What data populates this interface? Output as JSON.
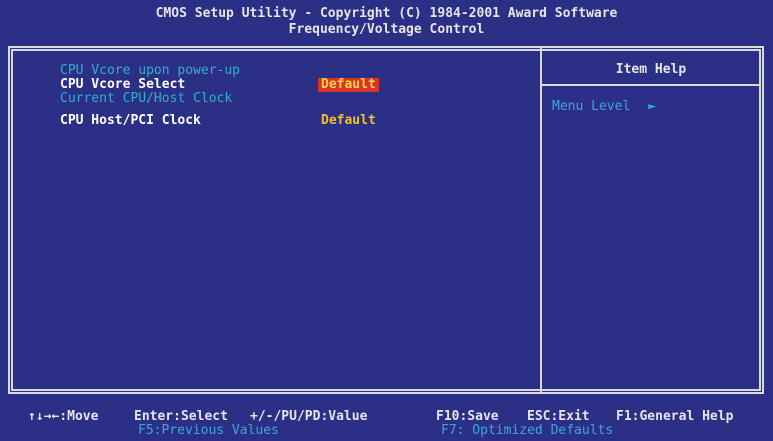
{
  "header": {
    "line1": "CMOS Setup Utility - Copyright (C) 1984-2001 Award Software",
    "line2": "Frequency/Voltage Control"
  },
  "items": [
    {
      "label": "CPU Vcore upon power-up",
      "value": "",
      "state": "disabled"
    },
    {
      "label": "CPU Vcore Select",
      "value": "Default",
      "state": "selected"
    },
    {
      "label": "Current CPU/Host Clock",
      "value": "",
      "state": "disabled"
    },
    {
      "label": "CPU Host/PCI Clock",
      "value": "Default",
      "state": "normal"
    }
  ],
  "help": {
    "title": "Item Help",
    "menu_level_label": "Menu Level",
    "menu_level_arrow": "►"
  },
  "footer": {
    "move": "↑↓→←:Move",
    "enter": "Enter:Select",
    "value": "+/-/PU/PD:Value",
    "save": "F10:Save",
    "exit": "ESC:Exit",
    "general_help": "F1:General Help",
    "previous_values": "F5:Previous Values",
    "optimized_defaults": "F7: Optimized Defaults"
  },
  "colors": {
    "background": "#2b2f86",
    "border": "#dadada",
    "disabled_text": "#2fb0c8",
    "value_text": "#f2c02a",
    "selection_bg": "#d9342a"
  }
}
